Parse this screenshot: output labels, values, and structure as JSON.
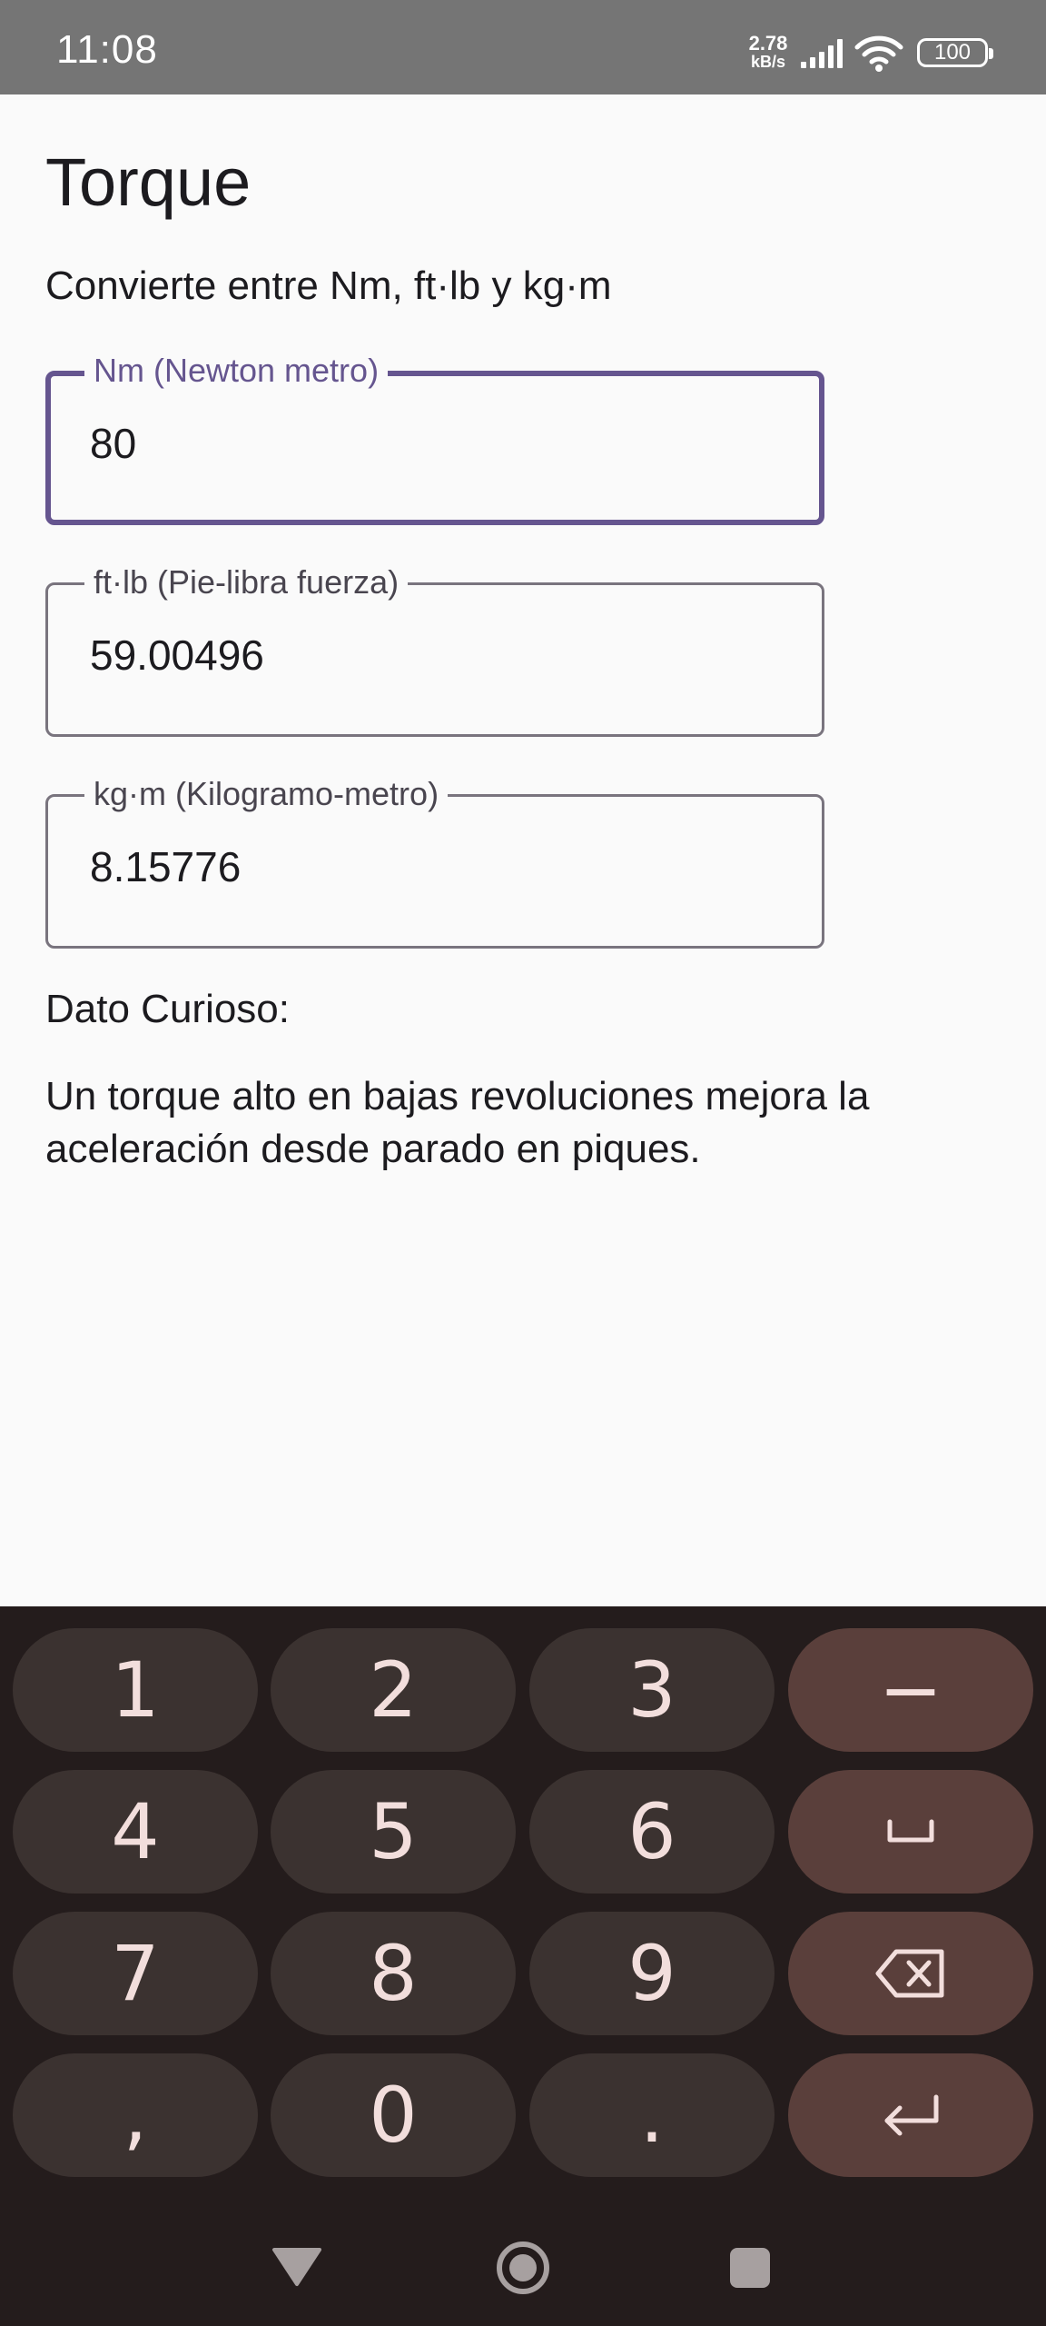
{
  "status_bar": {
    "time": "11:08",
    "net_speed_value": "2.78",
    "net_speed_unit": "kB/s",
    "battery": "100"
  },
  "app": {
    "title": "Torque",
    "subtitle": "Convierte entre Nm, ft·lb y kg·m"
  },
  "fields": [
    {
      "label": "Nm (Newton metro)",
      "value": "80",
      "focused": true
    },
    {
      "label": "ft·lb (Pie-libra fuerza)",
      "value": "59.00496",
      "focused": false
    },
    {
      "label": "kg·m (Kilogramo-metro)",
      "value": "8.15776",
      "focused": false
    }
  ],
  "fact": {
    "heading": "Dato Curioso:",
    "text": "Un torque alto en bajas revoluciones mejora la aceleración desde parado en piques."
  },
  "keyboard": {
    "keys": [
      "1",
      "2",
      "3",
      "−",
      "4",
      "5",
      "6",
      "␣",
      "7",
      "8",
      "9",
      "⌫",
      "，",
      "0",
      ".",
      "↵"
    ],
    "row1": [
      "1",
      "2",
      "3",
      "−"
    ],
    "row2": [
      "4",
      "5",
      "6"
    ],
    "row3": [
      "7",
      "8",
      "9"
    ],
    "row4": [
      ",",
      "0",
      "."
    ],
    "icons": {
      "space": "space-bar-icon",
      "backspace": "backspace-icon",
      "enter": "enter-icon"
    }
  },
  "colors": {
    "accent": "#65558f",
    "status_bar": "#757575",
    "keyboard_bg": "#241c1c",
    "key_bg": "#3b3230",
    "func_key_bg": "#5a3f3b",
    "key_text": "#f2dedc"
  }
}
